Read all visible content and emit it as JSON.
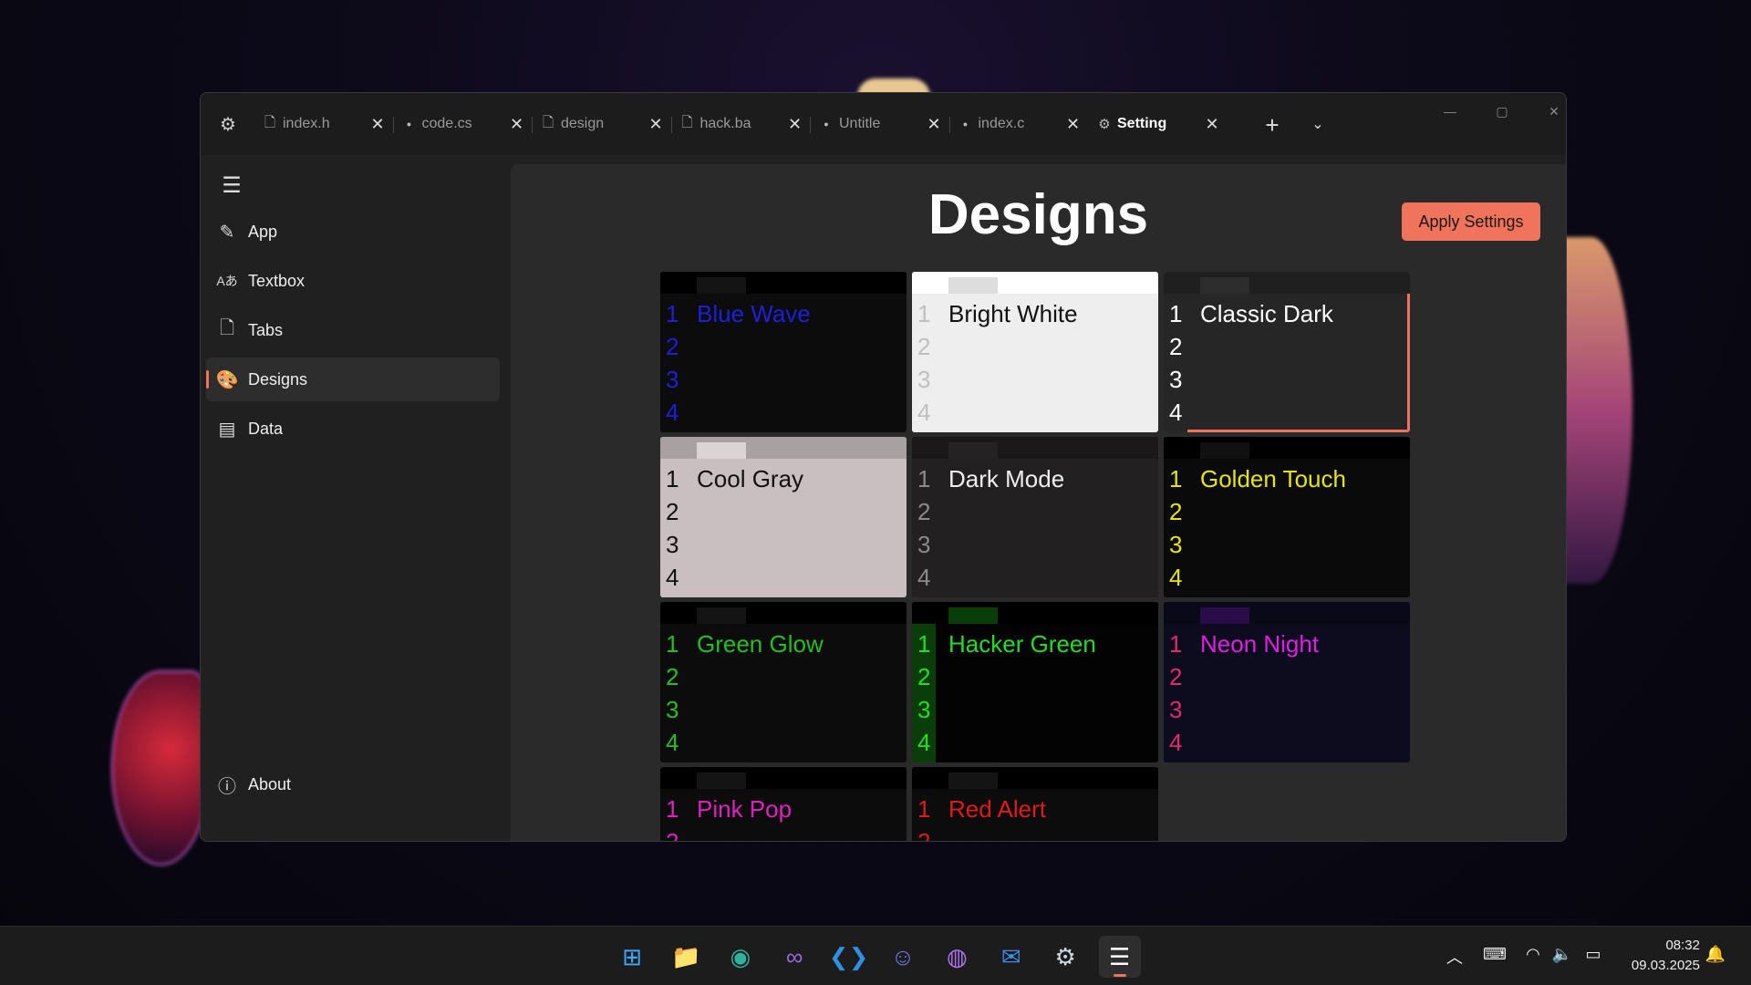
{
  "window": {
    "tabs": [
      {
        "label": "index.h",
        "icon": "file-icon"
      },
      {
        "label": "code.cs",
        "icon": "dot-icon"
      },
      {
        "label": "design",
        "icon": "file-icon"
      },
      {
        "label": "hack.ba",
        "icon": "file-icon"
      },
      {
        "label": "Untitle",
        "icon": "dot-icon"
      },
      {
        "label": "index.c",
        "icon": "dot-icon"
      },
      {
        "label": "Setting",
        "icon": "gear-icon",
        "active": true
      }
    ]
  },
  "sidebar": {
    "items": [
      {
        "label": "App",
        "icon": "pencil-icon"
      },
      {
        "label": "Textbox",
        "icon": "font-icon"
      },
      {
        "label": "Tabs",
        "icon": "document-icon"
      },
      {
        "label": "Designs",
        "icon": "palette-icon",
        "selected": true
      },
      {
        "label": "Data",
        "icon": "data-icon"
      }
    ],
    "about_label": "About"
  },
  "main": {
    "title": "Designs",
    "apply_label": "Apply Settings"
  },
  "designs": [
    {
      "name": "Blue Wave",
      "bg": "#0c0c0c",
      "bar": "#000000",
      "chip": "#141414",
      "gutter": "#0c0c0c",
      "text": "#1f1fd8",
      "num": "#1f1fd8"
    },
    {
      "name": "Bright White",
      "bg": "#eeeeee",
      "bar": "#ffffff",
      "chip": "#dddddd",
      "gutter": "#eeeeee",
      "text": "#111111",
      "num": "#bfbfbf"
    },
    {
      "name": "Classic Dark",
      "bg": "#262626",
      "bar": "#1f1f1f",
      "chip": "#2d2d2d",
      "gutter": "#262626",
      "text": "#ffffff",
      "num": "#ffffff",
      "selected": true
    },
    {
      "name": "Cool Gray",
      "bg": "#c9bfc0",
      "bar": "#a9a0a1",
      "chip": "#dcd4d4",
      "gutter": "#c9bfc0",
      "text": "#111111",
      "num": "#111111"
    },
    {
      "name": "Dark Mode",
      "bg": "#222020",
      "bar": "#1a1818",
      "chip": "#242222",
      "gutter": "#222020",
      "text": "#eeeeee",
      "num": "#8a8a8a"
    },
    {
      "name": "Golden Touch",
      "bg": "#0a0a0a",
      "bar": "#000000",
      "chip": "#111111",
      "gutter": "#0a0a0a",
      "text": "#e6e600",
      "num": "#e6e600"
    },
    {
      "name": "Green Glow",
      "bg": "#0c0c0c",
      "bar": "#000000",
      "chip": "#141414",
      "gutter": "#0c0c0c",
      "text": "#22c022",
      "num": "#22c022"
    },
    {
      "name": "Hacker Green",
      "bg": "#030303",
      "bar": "#000000",
      "chip": "#0a3d0a",
      "gutter": "#0a3d0a",
      "text": "#22dd22",
      "num": "#22dd22"
    },
    {
      "name": "Neon Night",
      "bg": "#0d0c1e",
      "bar": "#0a0918",
      "chip": "#2a0c4a",
      "gutter": "#0d0c1e",
      "text": "#e020e0",
      "num": "#e02a6a"
    },
    {
      "name": "Pink Pop",
      "bg": "#0c0c0c",
      "bar": "#000000",
      "chip": "#141414",
      "gutter": "#0c0c0c",
      "text": "#e020c0",
      "num": "#e020c0"
    },
    {
      "name": "Red Alert",
      "bg": "#0c0c0c",
      "bar": "#000000",
      "chip": "#141414",
      "gutter": "#0c0c0c",
      "text": "#e01a1a",
      "num": "#e01a1a"
    }
  ],
  "line_numbers": [
    "1",
    "2",
    "3",
    "4"
  ],
  "taskbar": {
    "apps": [
      "windows-start-icon",
      "file-explorer-icon",
      "edge-icon",
      "visual-studio-icon",
      "vscode-icon",
      "discord-icon",
      "github-icon",
      "thunderbird-icon",
      "settings-icon",
      "textpad-icon"
    ],
    "time": "08:32",
    "date": "09.03.2025"
  },
  "colors": {
    "accent": "#f0735b"
  }
}
